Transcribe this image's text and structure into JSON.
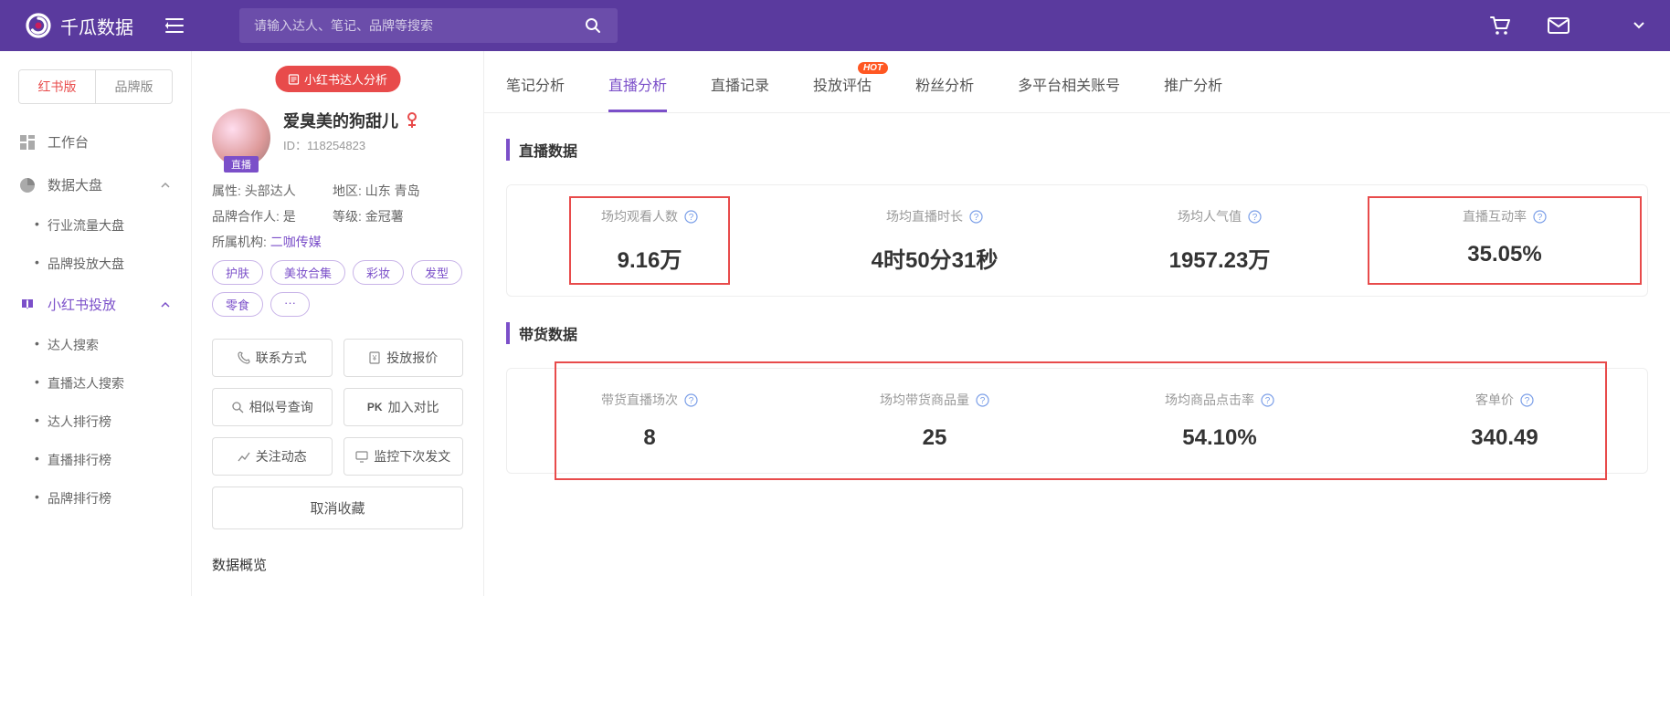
{
  "header": {
    "brand": "千瓜数据",
    "search_placeholder": "请输入达人、笔记、品牌等搜索"
  },
  "sidebar": {
    "version_tabs": [
      "红书版",
      "品牌版"
    ],
    "items": [
      {
        "label": "工作台",
        "type": "item"
      },
      {
        "label": "数据大盘",
        "type": "group",
        "subs": [
          "行业流量大盘",
          "品牌投放大盘"
        ]
      },
      {
        "label": "小红书投放",
        "type": "group",
        "active": true,
        "subs": [
          "达人搜索",
          "直播达人搜索",
          "达人排行榜",
          "直播排行榜",
          "品牌排行榜"
        ]
      }
    ]
  },
  "profile": {
    "analysis_badge": "小红书达人分析",
    "name": "爱臭美的狗甜儿",
    "id_label": "ID：118254823",
    "live_badge": "直播",
    "attrs": {
      "a1_label": "属性: 头部达人",
      "a1_region": "地区: 山东 青岛",
      "a2_label": "品牌合作人: 是",
      "a2_level": "等级: 金冠薯",
      "a3_label": "所属机构: ",
      "a3_org": "二咖传媒"
    },
    "tags": [
      "护肤",
      "美妆合集",
      "彩妆",
      "发型",
      "零食",
      "···"
    ],
    "actions": {
      "contact": "联系方式",
      "quote": "投放报价",
      "similar": "相似号查询",
      "compare_prefix": "PK",
      "compare": "加入对比",
      "follow": "关注动态",
      "monitor": "监控下次发文",
      "cancel_fav": "取消收藏"
    },
    "section_overview": "数据概览"
  },
  "tabs": [
    "笔记分析",
    "直播分析",
    "直播记录",
    "投放评估",
    "粉丝分析",
    "多平台相关账号",
    "推广分析"
  ],
  "tabs_hot": "HOT",
  "sections": {
    "live_data": "直播数据",
    "sales_data": "带货数据"
  },
  "live_stats": [
    {
      "label": "场均观看人数",
      "value": "9.16万",
      "highlight": true
    },
    {
      "label": "场均直播时长",
      "value": "4时50分31秒"
    },
    {
      "label": "场均人气值",
      "value": "1957.23万"
    },
    {
      "label": "直播互动率",
      "value": "35.05%",
      "highlight": true
    }
  ],
  "sales_stats": [
    {
      "label": "带货直播场次",
      "value": "8"
    },
    {
      "label": "场均带货商品量",
      "value": "25"
    },
    {
      "label": "场均商品点击率",
      "value": "54.10%"
    },
    {
      "label": "客单价",
      "value": "340.49"
    }
  ]
}
